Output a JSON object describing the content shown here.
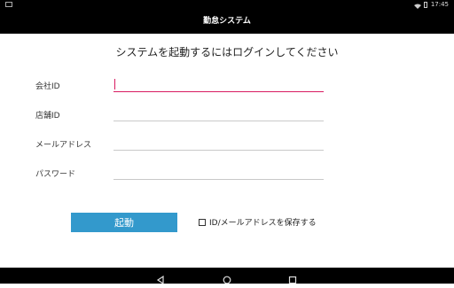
{
  "status": {
    "time": "17:45"
  },
  "header": {
    "title": "勤怠システム"
  },
  "main": {
    "heading": "システムを起動するにはログインしてください",
    "fields": [
      {
        "label": "会社ID",
        "value": "",
        "placeholder": ""
      },
      {
        "label": "店舗ID",
        "value": "",
        "placeholder": ""
      },
      {
        "label": "メールアドレス",
        "value": "",
        "placeholder": ""
      },
      {
        "label": "パスワード",
        "value": "",
        "placeholder": ""
      }
    ],
    "start_button": "起動",
    "save_checkbox_label": "ID/メールアドレスを保存する",
    "save_checked": false
  },
  "icons": {
    "status_left": "notification-icon",
    "wifi": "wifi-icon",
    "battery": "battery-icon",
    "back": "back-icon",
    "home": "home-icon",
    "recent": "recent-apps-icon"
  },
  "colors": {
    "accent": "#3399cc",
    "focus": "#d81b60",
    "bar": "#000000"
  }
}
